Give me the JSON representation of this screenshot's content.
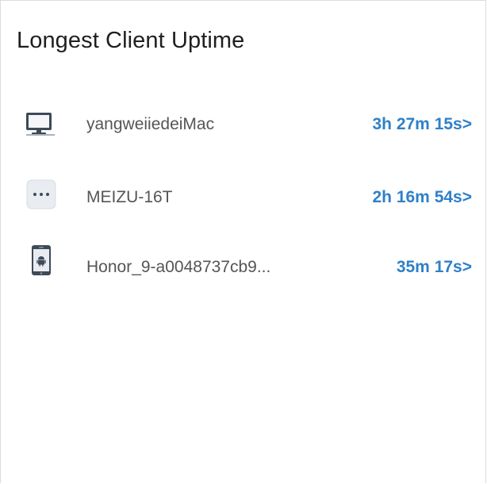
{
  "widget": {
    "title": "Longest Client Uptime"
  },
  "clients": [
    {
      "icon": "monitor-icon",
      "name": "yangweiiedeiMac",
      "uptime": "3h 27m 15s>"
    },
    {
      "icon": "more-dots-icon",
      "name": "MEIZU-16T",
      "uptime": "2h 16m 54s>"
    },
    {
      "icon": "android-phone-icon",
      "name": "Honor_9-a0048737cb9...",
      "uptime": "35m 17s>"
    }
  ],
  "colors": {
    "accent": "#2f80c8",
    "title": "#1f1f1f",
    "name": "#555555",
    "border": "#dcdcdc"
  }
}
